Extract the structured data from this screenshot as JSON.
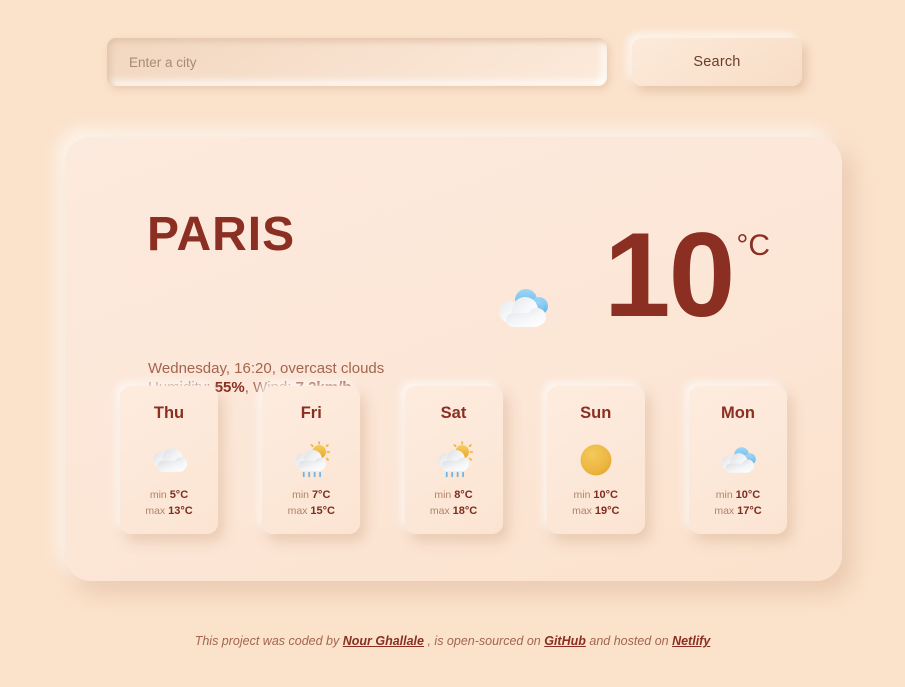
{
  "search": {
    "placeholder": "Enter a city",
    "value": "",
    "button_label": "Search"
  },
  "current": {
    "city": "PARIS",
    "description_line": "Wednesday, 16:20, overcast clouds",
    "humidity_label": "Humidity: ",
    "humidity_value": "55%",
    "wind_label": ", Wind: ",
    "wind_value": "7.2km/h",
    "temperature": "10",
    "unit": "°C",
    "icon": "broken-clouds-icon"
  },
  "forecast": [
    {
      "day": "Thu",
      "icon": "overcast-clouds-icon",
      "min_label": "min ",
      "min": "5°C",
      "max_label": "max ",
      "max": "13°C"
    },
    {
      "day": "Fri",
      "icon": "sun-rain-icon",
      "min_label": "min ",
      "min": "7°C",
      "max_label": "max ",
      "max": "15°C"
    },
    {
      "day": "Sat",
      "icon": "sun-rain-icon",
      "min_label": "min ",
      "min": "8°C",
      "max_label": "max ",
      "max": "18°C"
    },
    {
      "day": "Sun",
      "icon": "clear-sun-icon",
      "min_label": "min ",
      "min": "10°C",
      "max_label": "max ",
      "max": "19°C"
    },
    {
      "day": "Mon",
      "icon": "broken-clouds-icon",
      "min_label": "min ",
      "min": "10°C",
      "max_label": "max ",
      "max": "17°C"
    }
  ],
  "footer": {
    "prefix": "This project was coded by ",
    "author": "Nour Ghallale",
    "middle": " , is open-sourced on ",
    "repo": "GitHub",
    "after_repo": " and hosted on ",
    "host": "Netlify"
  },
  "colors": {
    "page_background": "#fbe2cb",
    "card_background": "#fde9db",
    "accent_dark": "#8a2f21",
    "muted_text": "#a4654f",
    "sun": "#edb843",
    "cloud_blue": "#7fc4ef"
  }
}
